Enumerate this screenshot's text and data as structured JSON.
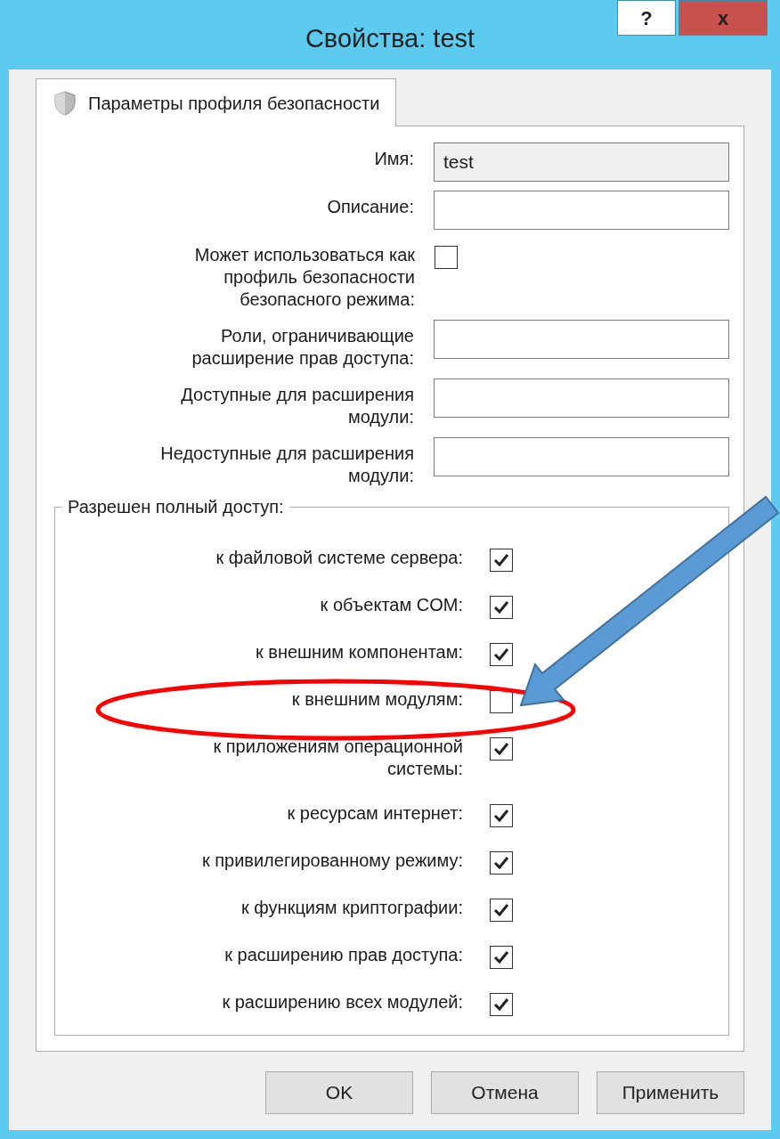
{
  "window": {
    "title": "Свойства: test",
    "help_button": "?",
    "close_button": "x"
  },
  "tabs": [
    {
      "label": "Параметры профиля безопасности",
      "selected": true
    }
  ],
  "fields": [
    {
      "kind": "text",
      "label": "Имя:",
      "value": "test",
      "disabled": true
    },
    {
      "kind": "text",
      "label": "Описание:"
    },
    {
      "kind": "checkbox",
      "label": "Может использоваться как профиль безопасности безопасного режима:",
      "checked": false
    },
    {
      "kind": "text",
      "label": "Роли, ограничивающие расширение прав доступа:"
    },
    {
      "kind": "text",
      "label": "Доступные для расширения модули:"
    },
    {
      "kind": "text",
      "label": "Недоступные для расширения модули:"
    }
  ],
  "group": {
    "title": "Разрешен полный доступ:",
    "items": [
      {
        "label": "к файловой системе сервера:",
        "checked": true
      },
      {
        "label": "к объектам COM:",
        "checked": true
      },
      {
        "label": "к внешним компонентам:",
        "checked": true
      },
      {
        "label": "к внешним модулям:",
        "checked": false
      },
      {
        "label": "к приложениям операционной системы:",
        "checked": true
      },
      {
        "label": "к ресурсам интернет:",
        "checked": true
      },
      {
        "label": "к привилегированному режиму:",
        "checked": true
      },
      {
        "label": "к функциям криптографии:",
        "checked": true
      },
      {
        "label": "к расширению прав доступа:",
        "checked": true
      },
      {
        "label": "к расширению всех модулей:",
        "checked": true
      }
    ]
  },
  "buttons": [
    "OK",
    "Отмена",
    "Применить"
  ],
  "annotations": [
    {
      "kind": "ellipse",
      "color": "#ff0000"
    },
    {
      "kind": "arrow",
      "color": "#5b9bd5"
    }
  ]
}
